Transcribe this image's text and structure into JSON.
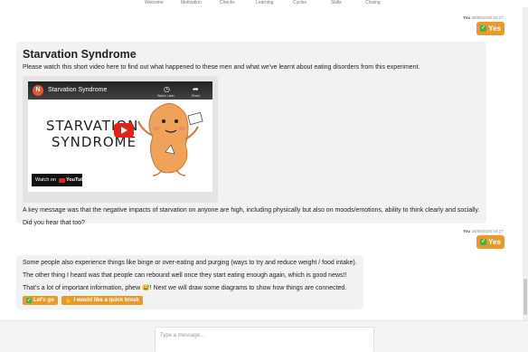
{
  "nav": {
    "items": [
      "Welcome",
      "Motivation",
      "Checks",
      "Learning",
      "Cycles",
      "Skills",
      "Closing"
    ]
  },
  "user_reply_1": {
    "name": "You",
    "time": "26/05/2025 04:27",
    "button": "Yes"
  },
  "bot_message_1": {
    "title": "Starvation Syndrome",
    "intro": "Please watch this short video here to find out what happened to these men and what we've learnt about eating disorders from this experiment.",
    "video": {
      "logo_letter": "N",
      "title": "Starvation Syndrome",
      "watch_later": "Watch Later",
      "share": "Share",
      "thumbnail_text_1": "STARVATION",
      "thumbnail_text_2": "SYNDROME",
      "watch_on": "Watch on",
      "youtube": "YouTube"
    },
    "para1": "A key message was that the negative impacts of starvation on anyone are high, including physically but also on moods/emotions, ability to think clearly and socially.",
    "para2": "Did you hear that too?"
  },
  "user_reply_2": {
    "name": "You",
    "time": "26/05/2025 04:27",
    "button": "Yes"
  },
  "bot_message_2": {
    "para1": "Some people also experience things like binge or over-eating and purging (ways to try and reduce weight / food intake).",
    "para2": "The other thing I heard was that people can rebound well once they start eating enough again, which is good news!!",
    "para3": "That's a lot of important information, phew 😅! Next we will draw some diagrams to show how things are connected.",
    "buttons": {
      "go": "Let's go",
      "break": "I would like a quick break"
    }
  },
  "composer": {
    "placeholder": "Type a message..."
  },
  "colors": {
    "accent": "#e89a2a",
    "check": "#39b54a",
    "youtube_red": "#e62117"
  }
}
